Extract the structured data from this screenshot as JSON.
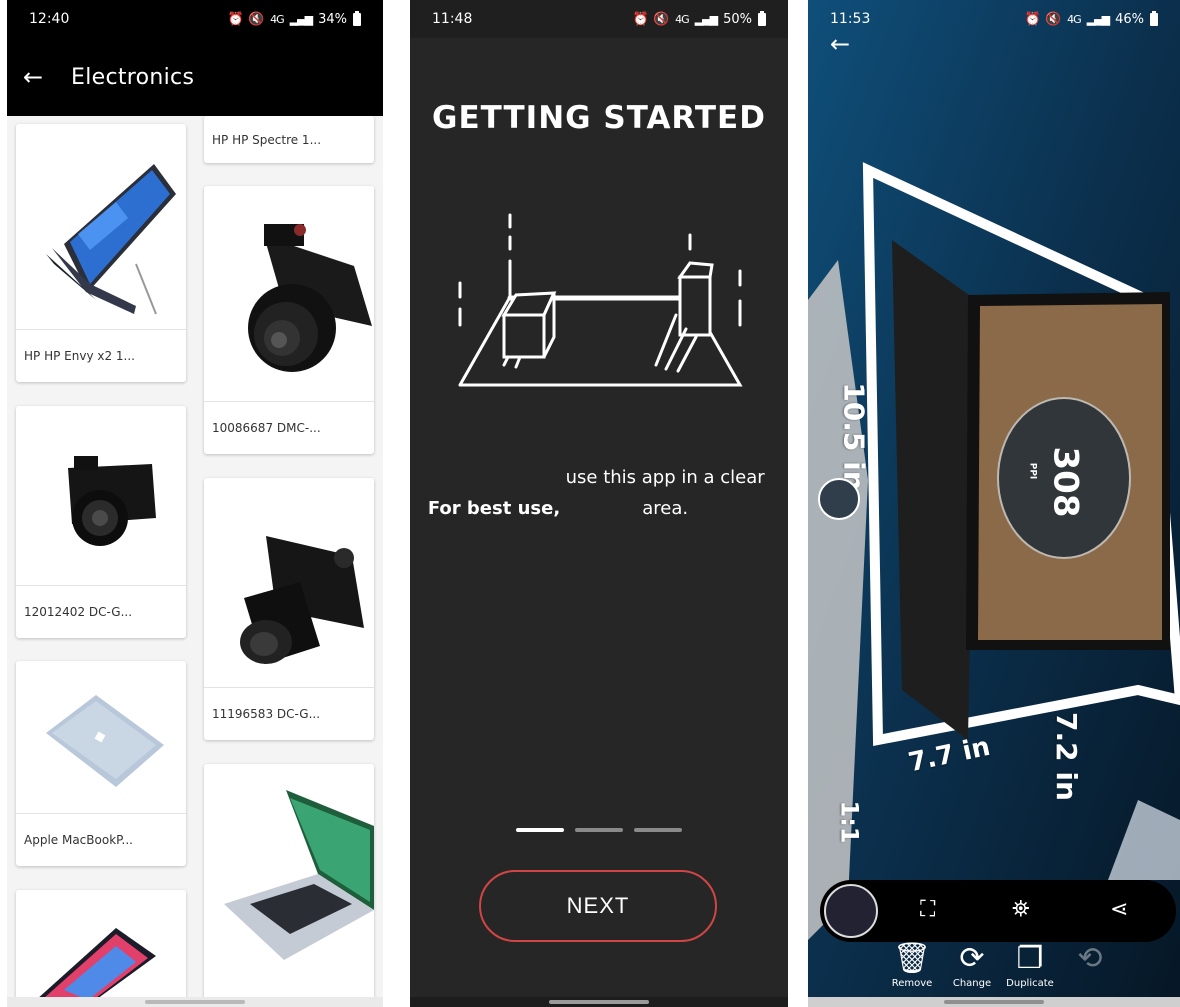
{
  "screens": {
    "catalog": {
      "status": {
        "time": "12:40",
        "icons": "⏰ 🔇",
        "network": "4G",
        "battery": "34%"
      },
      "appbar": {
        "title": "Electronics"
      },
      "products": [
        {
          "caption": "HP HP Spectre 1..."
        },
        {
          "caption": "HP HP Envy x2 1..."
        },
        {
          "caption": "10086687 DMC-..."
        },
        {
          "caption": "12012402 DC-G..."
        },
        {
          "caption": "11196583 DC-G..."
        },
        {
          "caption": "Apple MacBookP..."
        }
      ]
    },
    "onboarding": {
      "status": {
        "time": "11:48",
        "icons": "⏰ 🔇",
        "network": "4G",
        "battery": "50%"
      },
      "title": "GETTING STARTED",
      "tip_bold": "For best use,",
      "tip_rest": " use this app in a clear area.",
      "page_index": 1,
      "page_count": 3,
      "next_label": "NEXT"
    },
    "ar_view": {
      "status": {
        "time": "11:53",
        "icons": "⏰ 🔇",
        "network": "4G",
        "battery": "46%"
      },
      "measurements": {
        "height": "10.5 in",
        "width": "7.7 in",
        "depth": "7.2 in",
        "scale": "1:1"
      },
      "screen_number": "308",
      "screen_unit": "PPI",
      "actions": [
        {
          "label": "Remove"
        },
        {
          "label": "Change"
        },
        {
          "label": "Duplicate"
        }
      ]
    }
  },
  "colors": {
    "accent_red": "#d14545",
    "dark_bg": "#262626",
    "appbar": "#000000"
  }
}
